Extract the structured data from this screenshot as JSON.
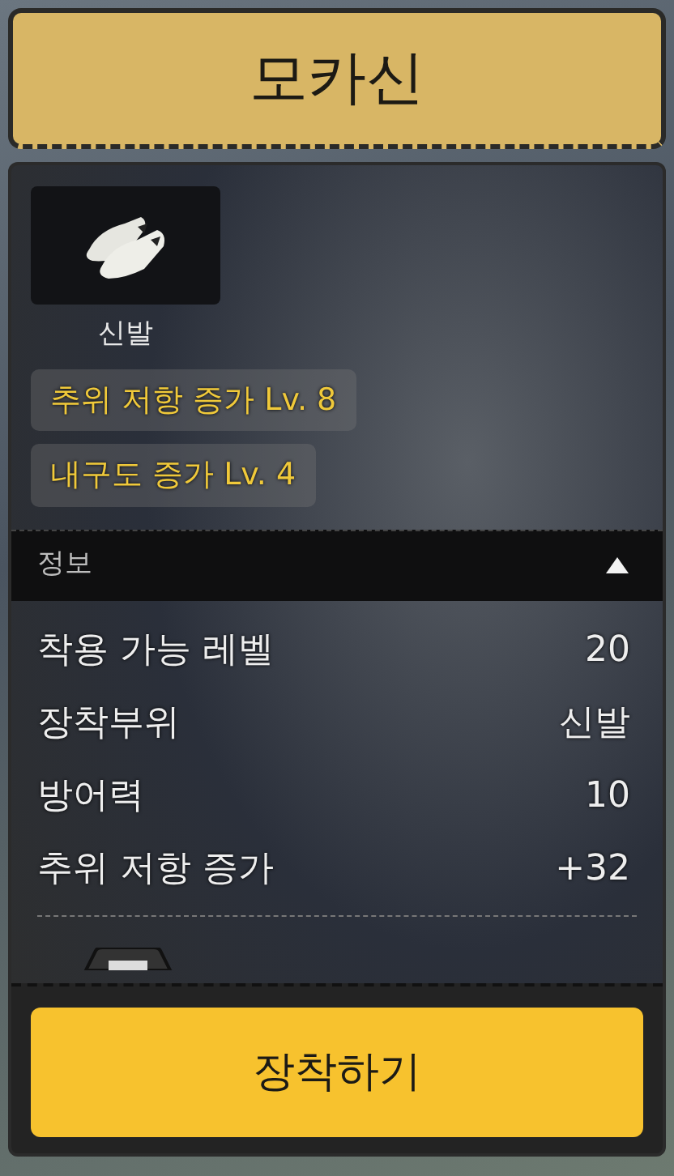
{
  "title": "모카신",
  "item": {
    "kind": "picture",
    "category": "신발"
  },
  "effects": [
    {
      "label": "추위 저항 증가 Lv. 8"
    },
    {
      "label": "내구도 증가 Lv. 4"
    }
  ],
  "info": {
    "title": "정보",
    "expanded": true,
    "rows": [
      {
        "label": "착용 가능 레벨",
        "value": "20"
      },
      {
        "label": "장착부위",
        "value": "신발"
      },
      {
        "label": "방어력",
        "value": "10"
      },
      {
        "label": "추위 저항 증가",
        "value": "+32"
      }
    ]
  },
  "button": "장착하기"
}
